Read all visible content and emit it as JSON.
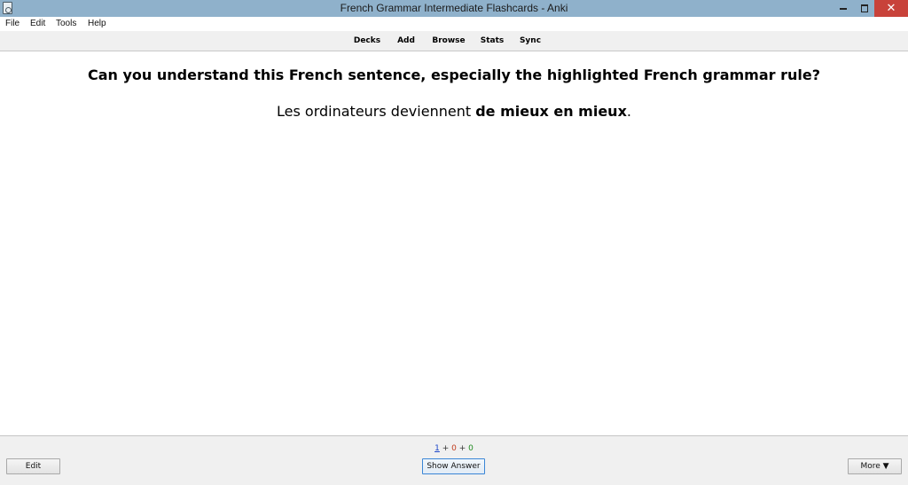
{
  "window": {
    "title": "French Grammar Intermediate Flashcards - Anki",
    "minimize_glyph": "",
    "close_glyph": "✕"
  },
  "menu": {
    "items": [
      "File",
      "Edit",
      "Tools",
      "Help"
    ]
  },
  "toolbar": {
    "items": [
      "Decks",
      "Add",
      "Browse",
      "Stats",
      "Sync"
    ]
  },
  "card": {
    "question": "Can you understand this French sentence, especially the highlighted French grammar rule?",
    "sentence_before": "Les ordinateurs deviennent ",
    "sentence_highlight": "de mieux en mieux",
    "sentence_after": "."
  },
  "counts": {
    "new": "1",
    "sep1": " + ",
    "learning": "0",
    "sep2": " + ",
    "review": "0"
  },
  "bottom": {
    "edit_label": "Edit",
    "show_answer_label": "Show Answer",
    "more_label": "More ▼"
  },
  "colors": {
    "titlebar": "#8fb1cb",
    "close_button": "#c8423a",
    "count_new": "#1a44c8",
    "count_learning": "#c03a1c",
    "count_review": "#1d8a1d"
  }
}
